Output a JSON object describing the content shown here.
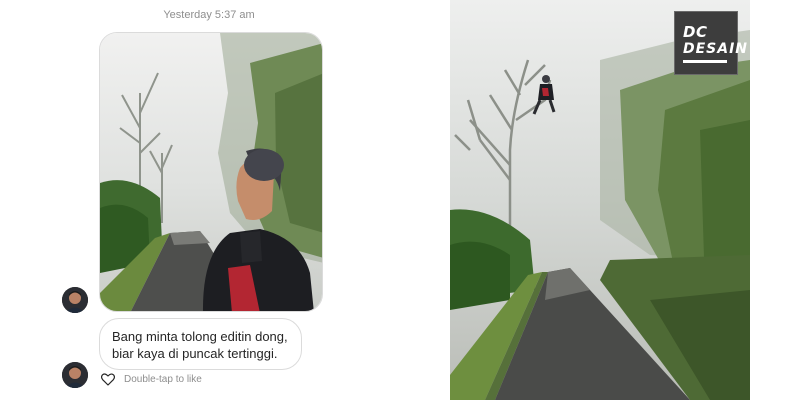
{
  "chat": {
    "timestamp": "Yesterday 5:37 am",
    "message_text": "Bang minta tolong editin dong, biar kaya di puncak tertinggi.",
    "like_hint": "Double-tap to like",
    "icons": [
      "heart-icon",
      "avatar"
    ]
  },
  "edited_image": {
    "logo_line1": "DC",
    "logo_line2": "DESAIN"
  },
  "colors": {
    "fog": "#d9dcdb",
    "foliage": "#5f7a43",
    "jacket_red": "#b32632",
    "logo_bg": "#3d3d3d"
  }
}
